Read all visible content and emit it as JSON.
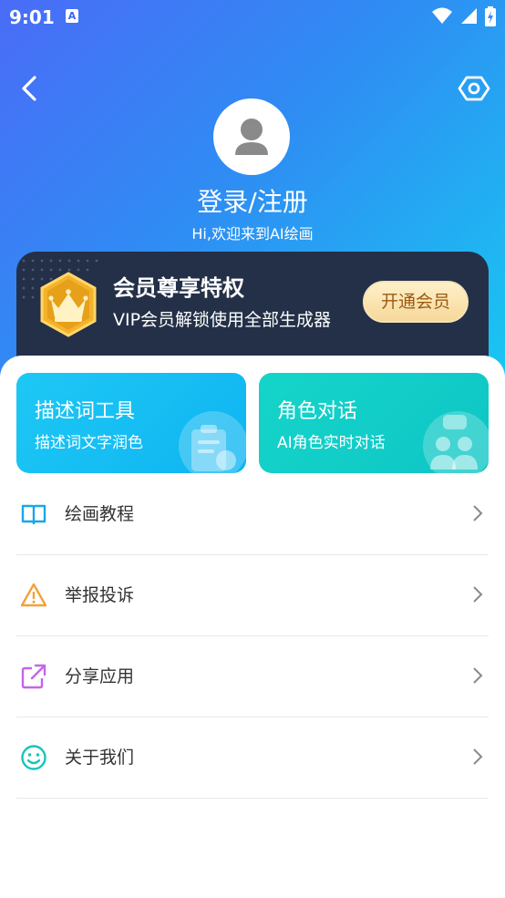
{
  "status_bar": {
    "time": "9:01",
    "notification_icon": "A",
    "icons": [
      "wifi-icon",
      "signal-icon",
      "battery-charging-icon"
    ]
  },
  "header": {
    "back_icon": "chevron-left-icon",
    "settings_icon": "hex-settings-icon"
  },
  "profile": {
    "avatar_icon": "person-icon",
    "login_text": "登录/注册",
    "welcome_text": "Hi,欢迎来到AI绘画"
  },
  "vip": {
    "badge_icon": "crown-badge-icon",
    "title": "会员尊享特权",
    "subtitle": "VIP会员解锁使用全部生成器",
    "button_label": "开通会员"
  },
  "tools": [
    {
      "title": "描述词工具",
      "subtitle": "描述词文字润色",
      "icon": "clipboard-edit-icon",
      "color": "#12bdf3"
    },
    {
      "title": "角色对话",
      "subtitle": "AI角色实时对话",
      "icon": "people-chat-icon",
      "color": "#12cdc8"
    }
  ],
  "menu": [
    {
      "label": "绘画教程",
      "icon": "book-icon",
      "color": "#1aa7e8"
    },
    {
      "label": "举报投诉",
      "icon": "warning-icon",
      "color": "#f2a23a"
    },
    {
      "label": "分享应用",
      "icon": "share-external-icon",
      "color": "#c266e8"
    },
    {
      "label": "关于我们",
      "icon": "smile-icon",
      "color": "#16c4c0"
    }
  ]
}
